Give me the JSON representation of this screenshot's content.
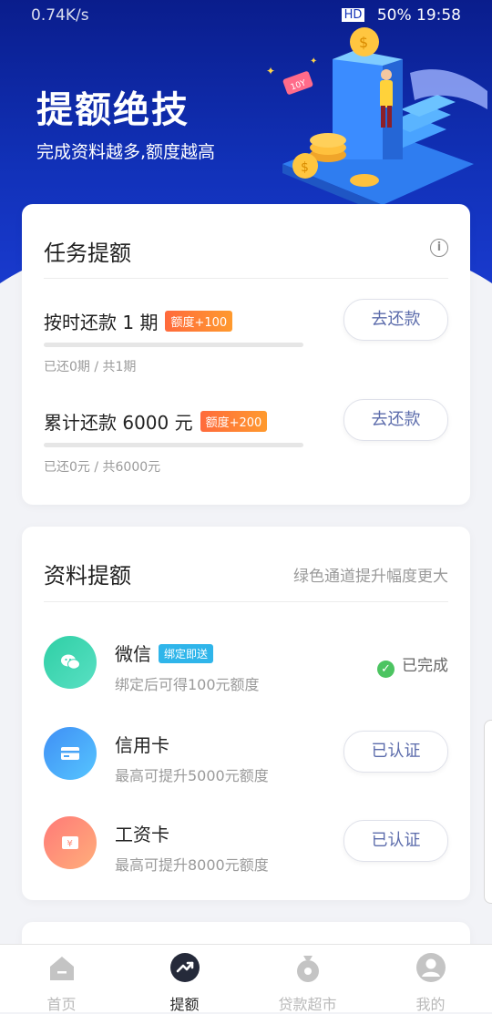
{
  "status_bar": {
    "left": "0.74K/s",
    "right": "50% 19:58",
    "hd": "HD"
  },
  "hero": {
    "title": "提额绝技",
    "subtitle": "完成资料越多,额度越高",
    "ticket_text": "10Y"
  },
  "tasks_card": {
    "title": "任务提额",
    "items": [
      {
        "name": "按时还款 1 期",
        "badge": "额度+100",
        "progress": 0.0,
        "meta": "已还0期 / 共1期",
        "button": "去还款"
      },
      {
        "name": "累计还款 6000 元",
        "badge": "额度+200",
        "progress": 0.0,
        "meta": "已还0元 / 共6000元",
        "button": "去还款"
      }
    ]
  },
  "profile_card": {
    "title": "资料提额",
    "note": "绿色通道提升幅度更大",
    "items": [
      {
        "name": "微信",
        "tag": "绑定即送",
        "desc": "绑定后可得100元额度",
        "status": "已完成",
        "icon": "wechat-icon",
        "color": "#3fd6b4"
      },
      {
        "name": "信用卡",
        "desc": "最高可提升5000元额度",
        "button": "已认证",
        "icon": "credit-card-icon",
        "color": "#42a7f5"
      },
      {
        "name": "工资卡",
        "desc": "最高可提升8000元额度",
        "button": "已认证",
        "icon": "yen-card-icon",
        "color": "#ff8f74"
      }
    ]
  },
  "tabbar": {
    "tabs": [
      {
        "label": "首页",
        "icon": "home-icon",
        "active": false
      },
      {
        "label": "提额",
        "icon": "trend-icon",
        "active": true
      },
      {
        "label": "贷款超市",
        "icon": "money-bag-icon",
        "active": false
      },
      {
        "label": "我的",
        "icon": "user-icon",
        "active": false
      }
    ]
  },
  "colors": {
    "hero_top": "#0a1d8c",
    "badge_orange": "#ff7a35",
    "tag_blue": "#2fb5ea",
    "done_green": "#4cc461"
  }
}
